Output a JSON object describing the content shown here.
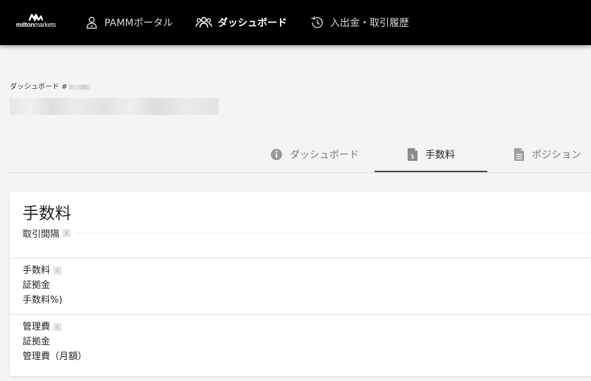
{
  "nav": {
    "logo": {
      "text_bold": "milton",
      "text_regular": "markets"
    },
    "items": [
      {
        "label": "PAMMポータル",
        "icon": "user-icon"
      },
      {
        "label": "ダッシュボード",
        "icon": "users-group-icon",
        "active": true
      },
      {
        "label": "入出金・取引履歴",
        "icon": "history-icon"
      }
    ]
  },
  "header": {
    "subtitle": "ダッシュボード #"
  },
  "tabs": [
    {
      "label": "ダッシュボード",
      "icon": "info-icon"
    },
    {
      "label": "手数料",
      "icon": "fee-document-icon",
      "active": true
    },
    {
      "label": "ポジション",
      "icon": "document-icon"
    }
  ],
  "fees": {
    "title": "手数料",
    "trade_interval_label": "取引間隔",
    "info_glyph": "i",
    "commission": {
      "label": "手数料",
      "line2": "証拠金",
      "line3": "手数料%)"
    },
    "management": {
      "label": "管理費",
      "line2": "証拠金",
      "line3": "管理費（月額）"
    }
  },
  "colors": {
    "topbar": "#000000",
    "active_tab_underline": "#3b4a56",
    "background": "#f4f4f4"
  }
}
